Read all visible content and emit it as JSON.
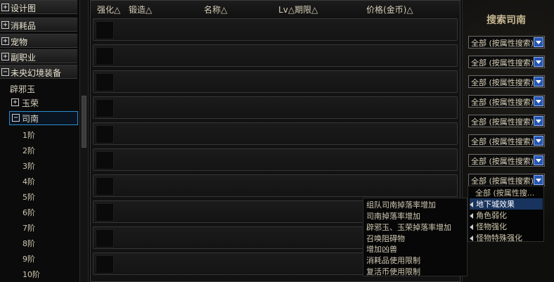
{
  "tree": {
    "categories": [
      {
        "label": "设计图",
        "toggle": "+"
      },
      {
        "label": "消耗品",
        "toggle": "+"
      },
      {
        "label": "宠物",
        "toggle": "+"
      },
      {
        "label": "副职业",
        "toggle": "+"
      },
      {
        "label": "未央幻境装备",
        "toggle": "−"
      }
    ],
    "node_bixie": "辟邪玉",
    "node_yurong": {
      "label": "玉荣",
      "toggle": "+"
    },
    "node_sinan": {
      "label": "司南",
      "toggle": "−"
    },
    "tiers": [
      "1阶",
      "2阶",
      "3阶",
      "4阶",
      "5阶",
      "6阶",
      "7阶",
      "8阶",
      "9阶",
      "10阶"
    ]
  },
  "list": {
    "headers": [
      "强化△",
      "锻造△",
      "名称△",
      "Lv△期限△",
      "价格(金币)△"
    ],
    "row_count": 10
  },
  "side": {
    "title": "搜索司南",
    "select_value": "全部 (按属性搜索)",
    "select_count": 8
  },
  "dropdown": {
    "items": [
      "全部 (按属性搜...",
      "地下城效果",
      "角色弱化",
      "怪物强化",
      "怪物特殊强化"
    ],
    "highlighted_index": 1
  },
  "submenu": {
    "items": [
      "组队司南掉落率增加",
      "司南掉落率增加",
      "辟邪玉、玉荣掉落率增加",
      "召唤阻碍物",
      "增加凶兽",
      "消耗品使用限制",
      "复活币使用限制"
    ]
  }
}
